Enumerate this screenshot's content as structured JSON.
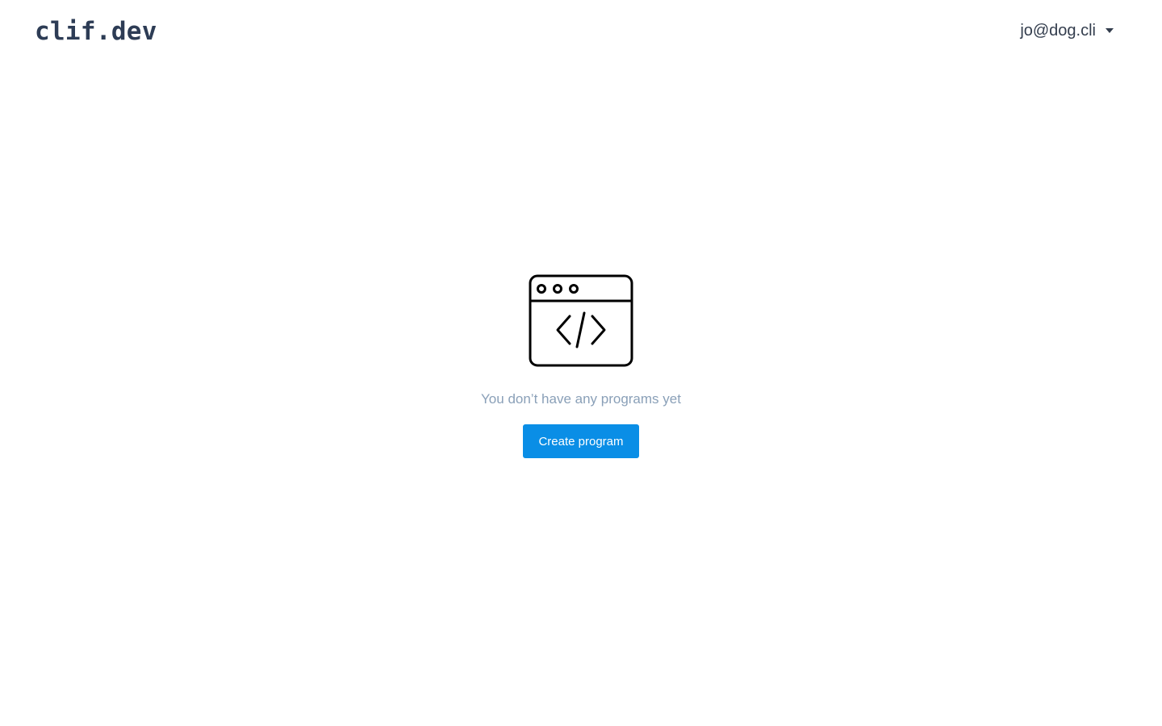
{
  "header": {
    "logo": "clif.dev",
    "user_email": "jo@dog.cli",
    "user_menu_icon": "caret-down-icon"
  },
  "main": {
    "empty_icon": "code-window-icon",
    "empty_message": "You don’t have any programs yet",
    "create_button_label": "Create program",
    "accent_color": "#0a8ee6"
  }
}
